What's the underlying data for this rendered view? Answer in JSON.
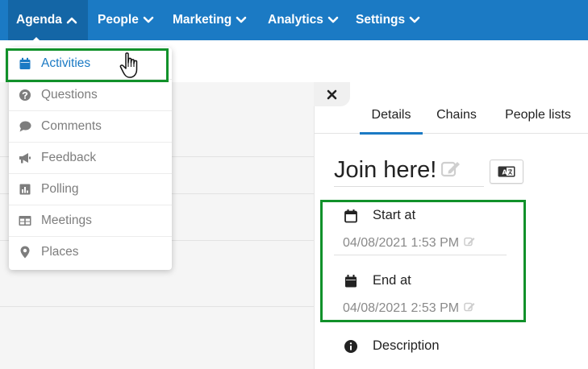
{
  "nav": {
    "items": [
      {
        "label": "Agenda",
        "active": true
      },
      {
        "label": "People"
      },
      {
        "label": "Marketing"
      },
      {
        "label": "Analytics"
      },
      {
        "label": "Settings"
      }
    ]
  },
  "dropdown": {
    "items": [
      {
        "label": "Activities",
        "icon": "calendar-icon",
        "active": true
      },
      {
        "label": "Questions",
        "icon": "question-circle-icon"
      },
      {
        "label": "Comments",
        "icon": "comment-icon"
      },
      {
        "label": "Feedback",
        "icon": "megaphone-icon"
      },
      {
        "label": "Polling",
        "icon": "bar-chart-icon"
      },
      {
        "label": "Meetings",
        "icon": "table-icon"
      },
      {
        "label": "Places",
        "icon": "map-pin-icon"
      }
    ]
  },
  "panel": {
    "close_label": "×",
    "tabs": [
      {
        "label": "Details",
        "active": true
      },
      {
        "label": "Chains"
      },
      {
        "label": "People lists"
      }
    ],
    "title": "Join here!",
    "start": {
      "label": "Start at",
      "value": "04/08/2021 1:53 PM"
    },
    "end": {
      "label": "End at",
      "value": "04/08/2021 2:53 PM"
    },
    "description_label": "Description"
  },
  "colors": {
    "nav_bg": "#1b7ac4",
    "nav_active": "#1466a6",
    "highlight": "#11912a",
    "accent": "#1b7ac4"
  }
}
